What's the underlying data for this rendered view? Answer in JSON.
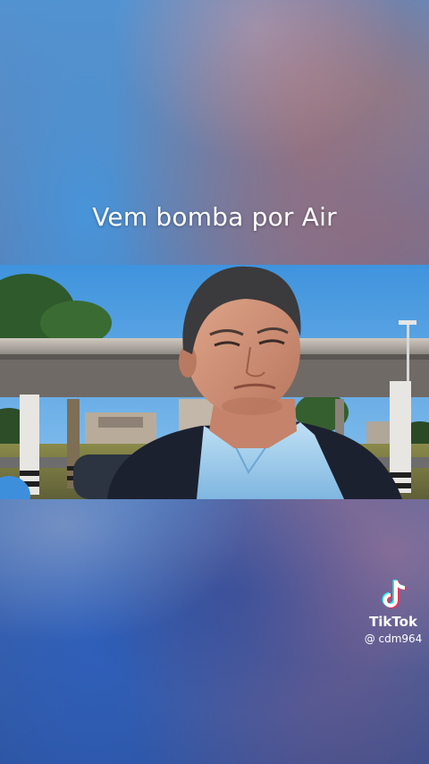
{
  "overlay_caption": "Vem bomba por Air",
  "watermark": {
    "brand": "TikTok",
    "username": "@ cdm964",
    "icon": "tiktok-logo-icon"
  },
  "colors": {
    "sky": "#4a9ae0",
    "tiktok_cyan": "#25f4ee",
    "tiktok_red": "#fe2c55"
  }
}
